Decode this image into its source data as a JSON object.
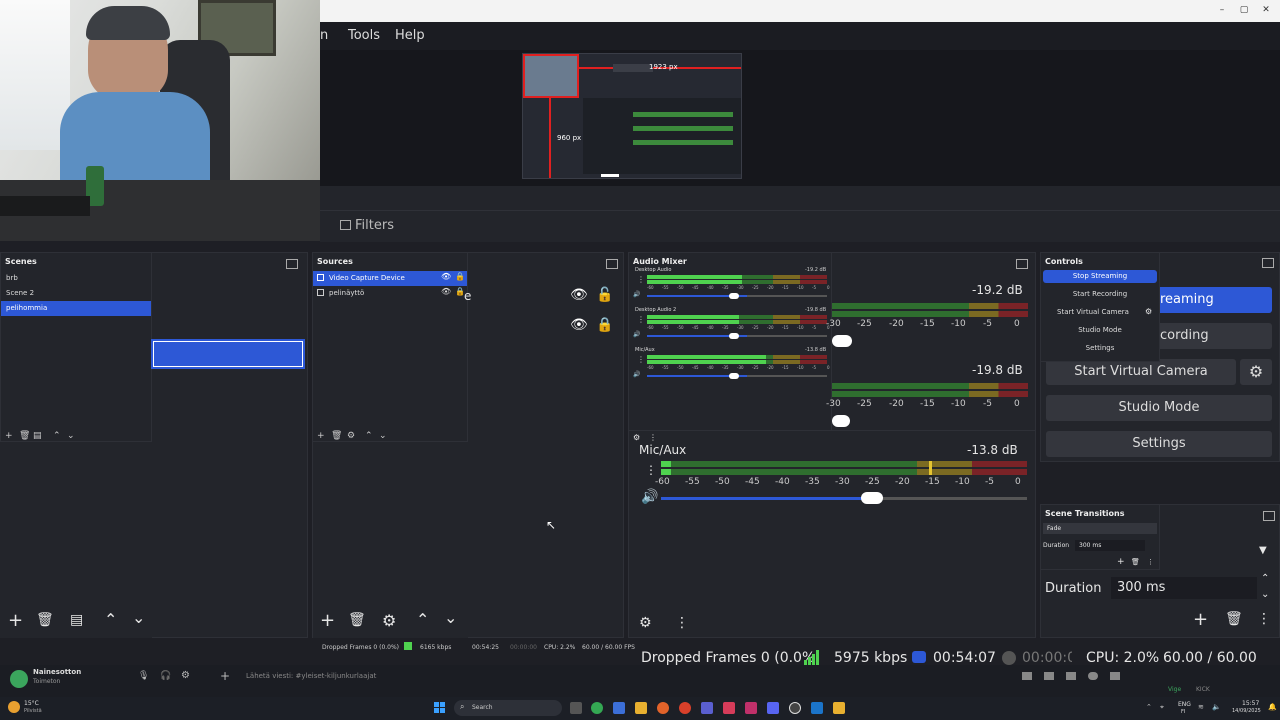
{
  "window": {
    "minimize": "–",
    "maximize": "▢",
    "close": "✕"
  },
  "menu": {
    "items": [
      "n",
      "Tools",
      "Help"
    ]
  },
  "preview": {
    "width_label": "1923 px",
    "height_label": "960 px"
  },
  "filters_label": "Filters",
  "scenes": {
    "title": "Scenes",
    "items": [
      "brb",
      "Scene 2",
      "pelihommia"
    ],
    "selected": 2
  },
  "sources": {
    "title": "Sources",
    "items": [
      "Video Capture Device",
      "pelinäyttö"
    ],
    "partial_label": "e"
  },
  "audio": {
    "title": "Audio Mixer",
    "channels": [
      {
        "name": "Desktop Audio",
        "db": "-19.2 dB",
        "level": 0.62
      },
      {
        "name": "Desktop Audio 2",
        "db": "-19.8 dB",
        "level": 0.6
      },
      {
        "name": "Mic/Aux",
        "db": "-13.8 dB",
        "level": 0.78
      }
    ],
    "scale_small": [
      "-60",
      "-55",
      "-50",
      "-45",
      "-40",
      "-35",
      "-30",
      "-25",
      "-20",
      "-15",
      "-10",
      "-5",
      "0"
    ],
    "scale_big": [
      "-30",
      "-25",
      "-20",
      "-15",
      "-10",
      "-5",
      "0"
    ],
    "big_db_1": "-19.2 dB",
    "big_db_2": "-19.8 dB",
    "mic_label": "Mic/Aux",
    "mic_db": "-13.8 dB",
    "mic_scale": [
      "-60",
      "-55",
      "-50",
      "-45",
      "-40",
      "-35",
      "-30",
      "-25",
      "-20",
      "-15",
      "-10",
      "-5",
      "0"
    ]
  },
  "controls": {
    "title": "Controls",
    "small": [
      "Stop Streaming",
      "Start Recording",
      "Start Virtual Camera",
      "Studio Mode",
      "Settings"
    ],
    "big": [
      "reaming",
      "cording",
      "Start Virtual Camera",
      "Studio Mode",
      "Settings"
    ]
  },
  "transitions": {
    "title": "Scene Transitions",
    "type": "Fade",
    "duration_label": "Duration",
    "duration_value": "300 ms"
  },
  "status_small": {
    "dropped": "Dropped Frames 0 (0.0%)",
    "kbps": "6165 kbps",
    "time": "00:54:25",
    "rec": "00:00:00",
    "cpu": "CPU: 2.2%",
    "fps": "60.00 / 60.00 FPS"
  },
  "status_big": {
    "dropped": "Dropped Frames 0 (0.0%",
    "kbps": "5975 kbps",
    "time": "00:54:07",
    "rec": "00:00:0C",
    "cpu": "CPU: 2.0%",
    "fps": "60.00 / 60.00 FPS"
  },
  "chat": {
    "user": "Nainesotton",
    "status": "Toimeton",
    "placeholder": "Lähetä viesti: #yleiset-kiljunkurlaajat",
    "right_label": "Vige",
    "right_sub": "KICK"
  },
  "taskbar": {
    "weather_temp": "15°C",
    "weather_desc": "Pilvistä",
    "search": "Search",
    "lang1": "ENG",
    "lang2": "FI",
    "clock": "15:57",
    "date": "14/09/2025"
  },
  "colors": {
    "accent": "#2d58d6",
    "green": "#4fd24f",
    "yellow": "#c9a32a",
    "red": "#b3262c"
  }
}
